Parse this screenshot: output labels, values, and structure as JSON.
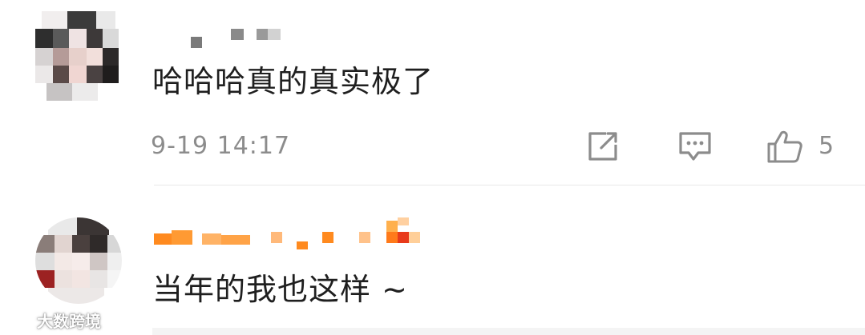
{
  "comments": [
    {
      "text": "哈哈哈真的真实极了",
      "time": "9-19 14:17",
      "likes": "5",
      "actions": {
        "share_icon": "share-icon",
        "reply_icon": "reply-icon",
        "like_icon": "thumbs-up-icon"
      }
    },
    {
      "text": "当年的我也这样 ~"
    }
  ],
  "watermark": {
    "text": "大数跨境"
  },
  "colors": {
    "text": "#1f1f1f",
    "meta": "#8c8c8c",
    "divider": "#e8e8e8",
    "name_blur_1": "#b7b7b7",
    "name_blur_2": "#ff7a1a"
  }
}
